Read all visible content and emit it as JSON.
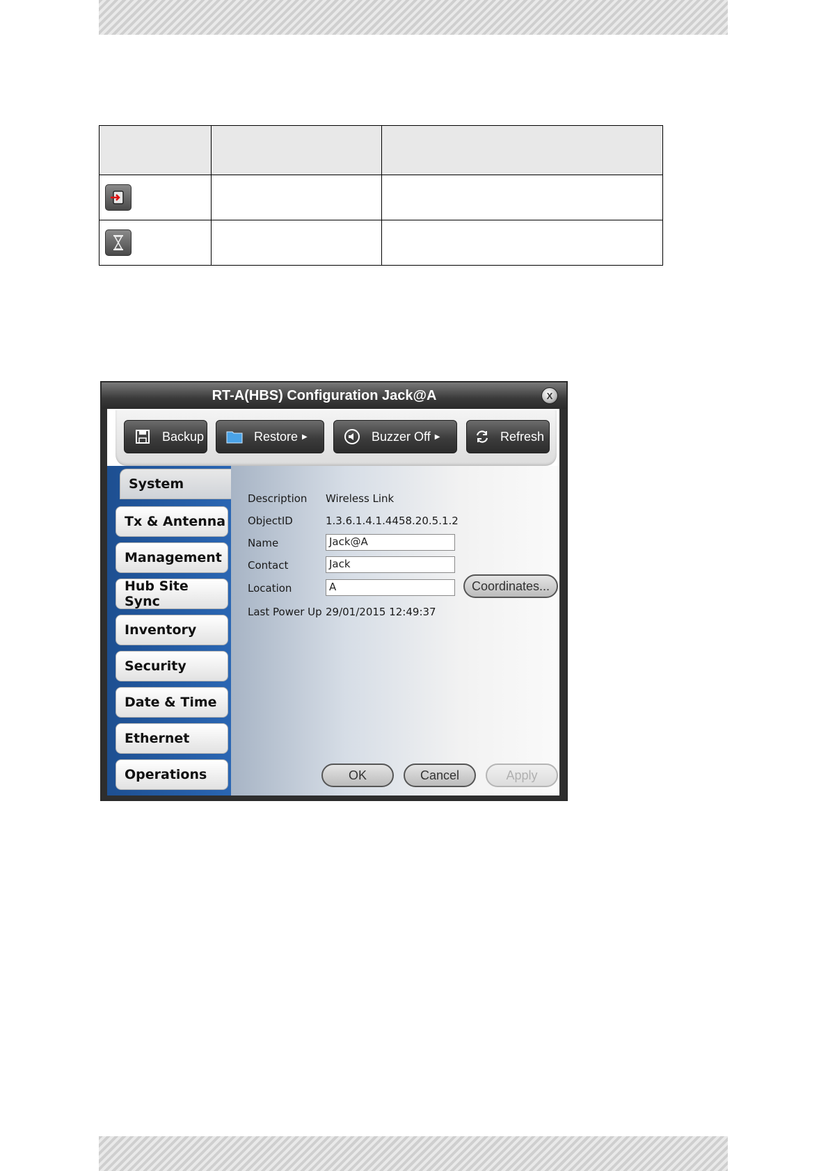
{
  "window": {
    "title": "RT-A(HBS) Configuration Jack@A",
    "toolbar": {
      "backup": "Backup",
      "restore": "Restore",
      "buzzer_off": "Buzzer Off",
      "refresh": "Refresh"
    },
    "tabs": [
      {
        "label": "System",
        "active": true
      },
      {
        "label": "Tx & Antenna",
        "active": false
      },
      {
        "label": "Management",
        "active": false
      },
      {
        "label": "Hub Site Sync",
        "active": false
      },
      {
        "label": "Inventory",
        "active": false
      },
      {
        "label": "Security",
        "active": false
      },
      {
        "label": "Date & Time",
        "active": false
      },
      {
        "label": "Ethernet",
        "active": false
      },
      {
        "label": "Operations",
        "active": false
      }
    ],
    "system": {
      "description_label": "Description",
      "description_value": "Wireless Link",
      "objectid_label": "ObjectID",
      "objectid_value": "1.3.6.1.4.1.4458.20.5.1.2",
      "name_label": "Name",
      "name_value": "Jack@A",
      "contact_label": "Contact",
      "contact_value": "Jack",
      "location_label": "Location",
      "location_value": "A",
      "coordinates_button": "Coordinates...",
      "last_power_up_label": "Last Power Up",
      "last_power_up_value": "29/01/2015 12:49:37"
    },
    "footer": {
      "ok": "OK",
      "cancel": "Cancel",
      "apply": "Apply"
    }
  },
  "reference_table": {
    "rows": [
      {
        "icon": "login-arrow-icon"
      },
      {
        "icon": "hourglass-icon"
      }
    ]
  },
  "colors": {
    "sidebar_accent": "#2a66b3",
    "title_bar": "#3a3a3a"
  }
}
